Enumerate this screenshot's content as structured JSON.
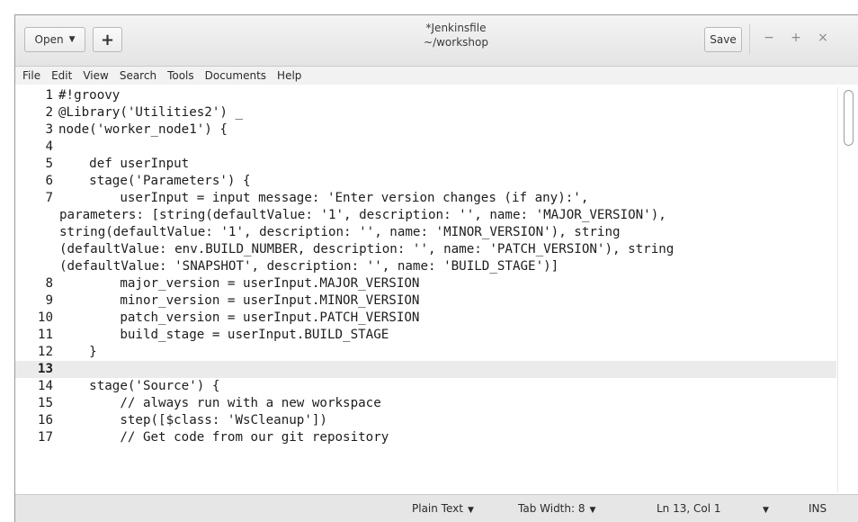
{
  "window": {
    "title": "*Jenkinsfile",
    "subtitle": "~/workshop",
    "open_label": "Open",
    "new_tab_label": "+",
    "save_label": "Save",
    "minimize_glyph": "−",
    "maximize_glyph": "+",
    "close_glyph": "×"
  },
  "menu": [
    "File",
    "Edit",
    "View",
    "Search",
    "Tools",
    "Documents",
    "Help"
  ],
  "editor": {
    "current_line": 13,
    "lines": [
      {
        "n": "1",
        "text": "#!groovy"
      },
      {
        "n": "2",
        "text": "@Library('Utilities2') _"
      },
      {
        "n": "3",
        "text": "node('worker_node1') {"
      },
      {
        "n": "4",
        "text": ""
      },
      {
        "n": "5",
        "text": "    def userInput"
      },
      {
        "n": "6",
        "text": "    stage('Parameters') {"
      },
      {
        "n": "7",
        "text": "        userInput = input message: 'Enter version changes (if any):',"
      },
      {
        "n": "",
        "text": "parameters: [string(defaultValue: '1', description: '', name: 'MAJOR_VERSION'),"
      },
      {
        "n": "",
        "text": "string(defaultValue: '1', description: '', name: 'MINOR_VERSION'), string"
      },
      {
        "n": "",
        "text": "(defaultValue: env.BUILD_NUMBER, description: '', name: 'PATCH_VERSION'), string"
      },
      {
        "n": "",
        "text": "(defaultValue: 'SNAPSHOT', description: '', name: 'BUILD_STAGE')]"
      },
      {
        "n": "8",
        "text": "        major_version = userInput.MAJOR_VERSION"
      },
      {
        "n": "9",
        "text": "        minor_version = userInput.MINOR_VERSION"
      },
      {
        "n": "10",
        "text": "        patch_version = userInput.PATCH_VERSION"
      },
      {
        "n": "11",
        "text": "        build_stage = userInput.BUILD_STAGE"
      },
      {
        "n": "12",
        "text": "    }"
      },
      {
        "n": "13",
        "text": ""
      },
      {
        "n": "14",
        "text": "    stage('Source') {"
      },
      {
        "n": "15",
        "text": "        // always run with a new workspace"
      },
      {
        "n": "16",
        "text": "        step([$class: 'WsCleanup'])"
      },
      {
        "n": "17",
        "text": "        // Get code from our git repository"
      }
    ]
  },
  "status": {
    "language": "Plain Text",
    "tab_width": "Tab Width: 8",
    "position": "Ln 13, Col 1",
    "mode": "INS"
  },
  "icons": {
    "dropdown": "chevron-down-icon",
    "scroll": "scrollbar"
  }
}
